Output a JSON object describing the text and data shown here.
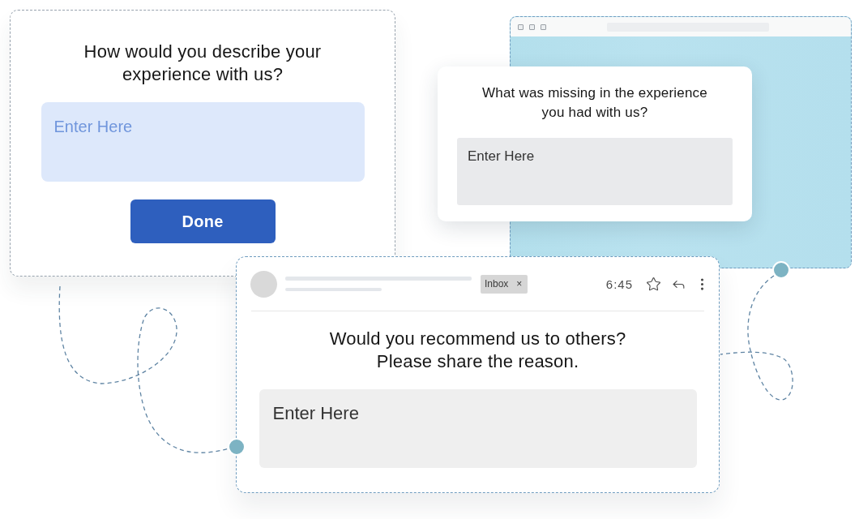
{
  "survey_card": {
    "question": "How would you describe your experience with us?",
    "answer_field": {
      "placeholder": "Enter Here"
    },
    "done_button": "Done"
  },
  "browser_window": {
    "popup": {
      "question": "What was missing in the experience you had with us?",
      "answer_field": {
        "placeholder": "Enter Here"
      }
    }
  },
  "email_card": {
    "label": {
      "text": "Inbox",
      "remove": "×"
    },
    "time": "6:45",
    "question": [
      "Would you recommend us to others?",
      "Please share the reason."
    ],
    "answer_field": {
      "placeholder": "Enter Here"
    }
  }
}
